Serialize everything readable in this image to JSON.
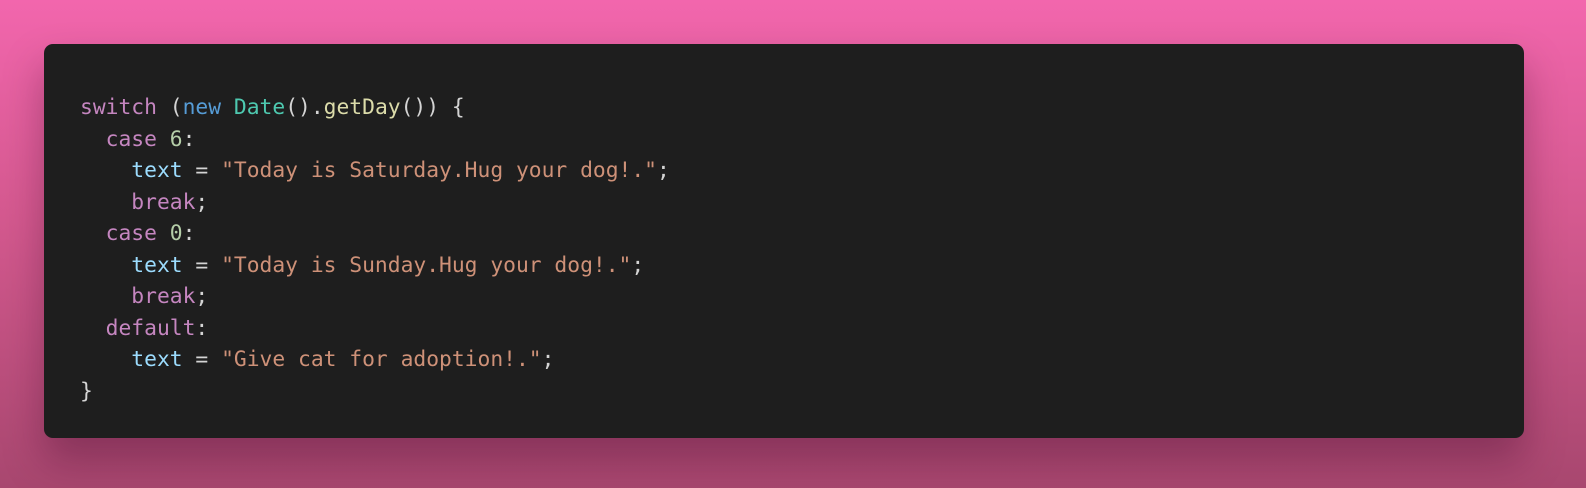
{
  "code_lines": [
    [
      {
        "t": "switch",
        "c": "kw"
      },
      {
        "t": " (",
        "c": "punc"
      },
      {
        "t": "new",
        "c": "kw-new"
      },
      {
        "t": " ",
        "c": "punc"
      },
      {
        "t": "Date",
        "c": "cls"
      },
      {
        "t": "().",
        "c": "punc"
      },
      {
        "t": "getDay",
        "c": "fn"
      },
      {
        "t": "()) {",
        "c": "punc"
      }
    ],
    [
      {
        "t": "  ",
        "c": "punc"
      },
      {
        "t": "case",
        "c": "kw"
      },
      {
        "t": " ",
        "c": "punc"
      },
      {
        "t": "6",
        "c": "num"
      },
      {
        "t": ":",
        "c": "punc"
      }
    ],
    [
      {
        "t": "    ",
        "c": "punc"
      },
      {
        "t": "text",
        "c": "var"
      },
      {
        "t": " = ",
        "c": "punc"
      },
      {
        "t": "\"Today is Saturday.Hug your dog!.\"",
        "c": "str"
      },
      {
        "t": ";",
        "c": "punc"
      }
    ],
    [
      {
        "t": "    ",
        "c": "punc"
      },
      {
        "t": "break",
        "c": "kw"
      },
      {
        "t": ";",
        "c": "punc"
      }
    ],
    [
      {
        "t": "  ",
        "c": "punc"
      },
      {
        "t": "case",
        "c": "kw"
      },
      {
        "t": " ",
        "c": "punc"
      },
      {
        "t": "0",
        "c": "num"
      },
      {
        "t": ":",
        "c": "punc"
      }
    ],
    [
      {
        "t": "    ",
        "c": "punc"
      },
      {
        "t": "text",
        "c": "var"
      },
      {
        "t": " = ",
        "c": "punc"
      },
      {
        "t": "\"Today is Sunday.Hug your dog!.\"",
        "c": "str"
      },
      {
        "t": ";",
        "c": "punc"
      }
    ],
    [
      {
        "t": "    ",
        "c": "punc"
      },
      {
        "t": "break",
        "c": "kw"
      },
      {
        "t": ";",
        "c": "punc"
      }
    ],
    [
      {
        "t": "  ",
        "c": "punc"
      },
      {
        "t": "default",
        "c": "kw"
      },
      {
        "t": ":",
        "c": "punc"
      }
    ],
    [
      {
        "t": "    ",
        "c": "punc"
      },
      {
        "t": "text",
        "c": "var"
      },
      {
        "t": " = ",
        "c": "punc"
      },
      {
        "t": "\"Give cat for adoption!.\"",
        "c": "str"
      },
      {
        "t": ";",
        "c": "punc"
      }
    ],
    [
      {
        "t": "}",
        "c": "punc"
      }
    ]
  ],
  "colors": {
    "background_top": "#f266ad",
    "background_bottom": "#a8476f",
    "editor_bg": "#1e1e1e",
    "keyword": "#c586c0",
    "keyword_new": "#569cd6",
    "class": "#4ec9b0",
    "function": "#dcdcaa",
    "number": "#b5cea8",
    "variable": "#9cdcfe",
    "string": "#ce9178",
    "punctuation": "#d4d4d4"
  }
}
